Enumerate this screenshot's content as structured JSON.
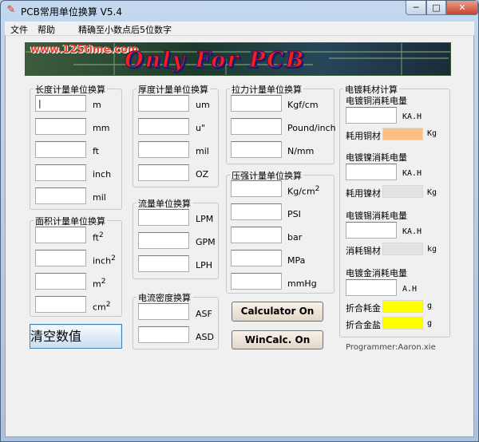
{
  "window": {
    "title": "PCB常用单位换算 V5.4",
    "btn_min": "─",
    "btn_max": "□",
    "btn_close": "✕"
  },
  "menu": {
    "file": "文件",
    "help": "帮助",
    "precision": "精确至小数点后5位数字"
  },
  "banner": {
    "url": "www.125time.com",
    "slogan": "Only For PCB"
  },
  "length": {
    "title": "长度计量单位换算",
    "units": [
      "m",
      "mm",
      "ft",
      "inch",
      "mil"
    ]
  },
  "area": {
    "title": "面积计量单位换算",
    "units": [
      "ft",
      "inch",
      "m",
      "cm"
    ],
    "exponent": "2"
  },
  "thickness": {
    "title": "厚度计量单位换算",
    "units": [
      "um",
      "u\"",
      "mil",
      "OZ"
    ]
  },
  "flow": {
    "title": "流量单位换算",
    "units": [
      "LPM",
      "GPM",
      "LPH"
    ]
  },
  "current_density": {
    "title": "电流密度换算",
    "units": [
      "ASF",
      "ASD"
    ]
  },
  "tension": {
    "title": "拉力计量单位换算",
    "units": [
      "Kgf/cm",
      "Pound/inch",
      "N/mm"
    ]
  },
  "pressure": {
    "title": "压强计量单位换算",
    "units": [
      "Kg/cm",
      "PSI",
      "bar",
      "MPa",
      "mmHg"
    ],
    "exponent": "2"
  },
  "plating": {
    "title": "电镀耗材计算",
    "copper_title": "电镀铜消耗电量",
    "copper_unit": "KA.H",
    "copper_use_label": "耗用铜材",
    "copper_use_unit": "Kg",
    "nickel_title": "电镀镍消耗电量",
    "nickel_unit": "KA.H",
    "nickel_use_label": "耗用镍材",
    "nickel_use_unit": "Kg",
    "tin_title": "电镀锡消耗电量",
    "tin_unit": "KA.H",
    "tin_use_label": "消耗锡材",
    "tin_use_unit": "kg",
    "gold_title": "电镀金消耗电量",
    "gold_unit": "A.H",
    "gold_use_label": "折合耗金",
    "gold_use_unit": "g",
    "gold_salt_label": "折合金盐",
    "gold_salt_unit": "g"
  },
  "buttons": {
    "calculator": "Calculator On",
    "wincalc": "WinCalc. On",
    "clear": "清空数值"
  },
  "programmer": "Programmer:Aaron.xie",
  "colors": {
    "copper_field": "#ffbf80",
    "gold_field": "#ffff00",
    "disabled_field": "#e3e3e3"
  }
}
